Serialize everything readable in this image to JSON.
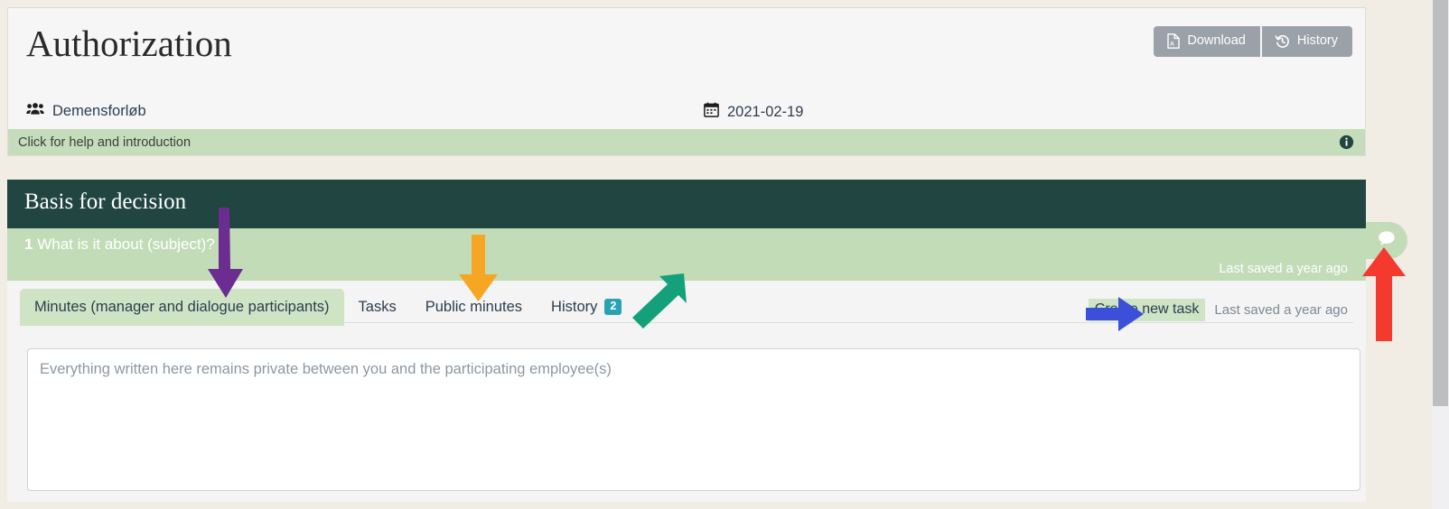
{
  "header": {
    "title": "Authorization",
    "download_label": "Download",
    "history_label": "History",
    "group_name": "Demensforløb",
    "date": "2021-02-19",
    "help_text": "Click for help and introduction",
    "download_icon": "file-pdf-icon",
    "history_icon": "history-clock-icon",
    "group_icon": "users-group-icon",
    "date_icon": "calendar-icon",
    "info_icon": "info-circle-icon"
  },
  "panel": {
    "title": "Basis for decision",
    "question_number": "1",
    "question_text": "What is it about (subject)?",
    "band_last_saved": "Last saved a year ago",
    "chat_icon": "comment-bubble-icon"
  },
  "tabs": [
    {
      "label": "Minutes (manager and dialogue participants)",
      "active": true,
      "badge": ""
    },
    {
      "label": "Tasks",
      "active": false,
      "badge": ""
    },
    {
      "label": "Public minutes",
      "active": false,
      "badge": ""
    },
    {
      "label": "History",
      "active": false,
      "badge": "2"
    }
  ],
  "toolbar": {
    "create_task_label": "Create new task",
    "last_saved": "Last saved a year ago"
  },
  "editor": {
    "placeholder": "Everything written here remains private between you and the participating employee(s)",
    "value": ""
  },
  "colors": {
    "page_background": "#f1ece4",
    "panel_header": "#214541",
    "green_band": "#c2dcb8",
    "active_tab": "#cfe3c5",
    "badge_teal": "#27a3b4",
    "button_gray": "#9aa1a9",
    "arrow_purple": "#6b2d8f",
    "arrow_orange": "#f5a623",
    "arrow_teal": "#13a07a",
    "arrow_blue": "#3b4fd8",
    "arrow_red": "#f4392f"
  },
  "annotations": [
    {
      "name": "purple-arrow",
      "color": "#6b2d8f",
      "points_to": "minutes-tab"
    },
    {
      "name": "orange-arrow",
      "color": "#f5a623",
      "points_to": "public-minutes-tab"
    },
    {
      "name": "teal-arrow",
      "color": "#13a07a",
      "points_to": "history-tab"
    },
    {
      "name": "blue-arrow",
      "color": "#3b4fd8",
      "points_to": "create-new-task-button"
    },
    {
      "name": "red-arrow",
      "color": "#f4392f",
      "points_to": "chat-tab"
    }
  ]
}
